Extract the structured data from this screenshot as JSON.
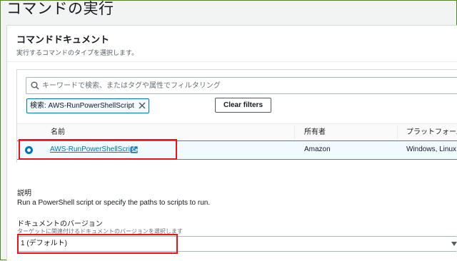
{
  "page": {
    "title": "コマンドの実行"
  },
  "document_panel": {
    "title": "コマンドドキュメント",
    "description": "実行するコマンドのタイプを選択します。"
  },
  "search": {
    "placeholder": "キーワードで検索、またはタグや属性でフィルタリング",
    "value": ""
  },
  "filter_token": {
    "label": "検索: AWS-RunPowerShellScript"
  },
  "clear_filters": {
    "label": "Clear filters"
  },
  "table": {
    "columns": [
      "名前",
      "所有者",
      "プラットフォーム"
    ],
    "rows": [
      {
        "name": "AWS-RunPowerShellScript",
        "owner": "Amazon",
        "platform": "Windows, Linux",
        "selected": true
      }
    ]
  },
  "description_section": {
    "label": "説明",
    "text": "Run a PowerShell script or specify the paths to scripts to run."
  },
  "version_section": {
    "label": "ドキュメントのバージョン",
    "hint": "ターゲットに関連付けるドキュメントのバージョンを選択します",
    "selected": "1 (デフォルト)"
  },
  "colors": {
    "accent": "#0073bb",
    "highlight": "#e8141c",
    "selected_row": "#f1faff"
  },
  "icons": [
    "search-icon",
    "close-icon",
    "external-link-icon",
    "caret-down-icon"
  ]
}
